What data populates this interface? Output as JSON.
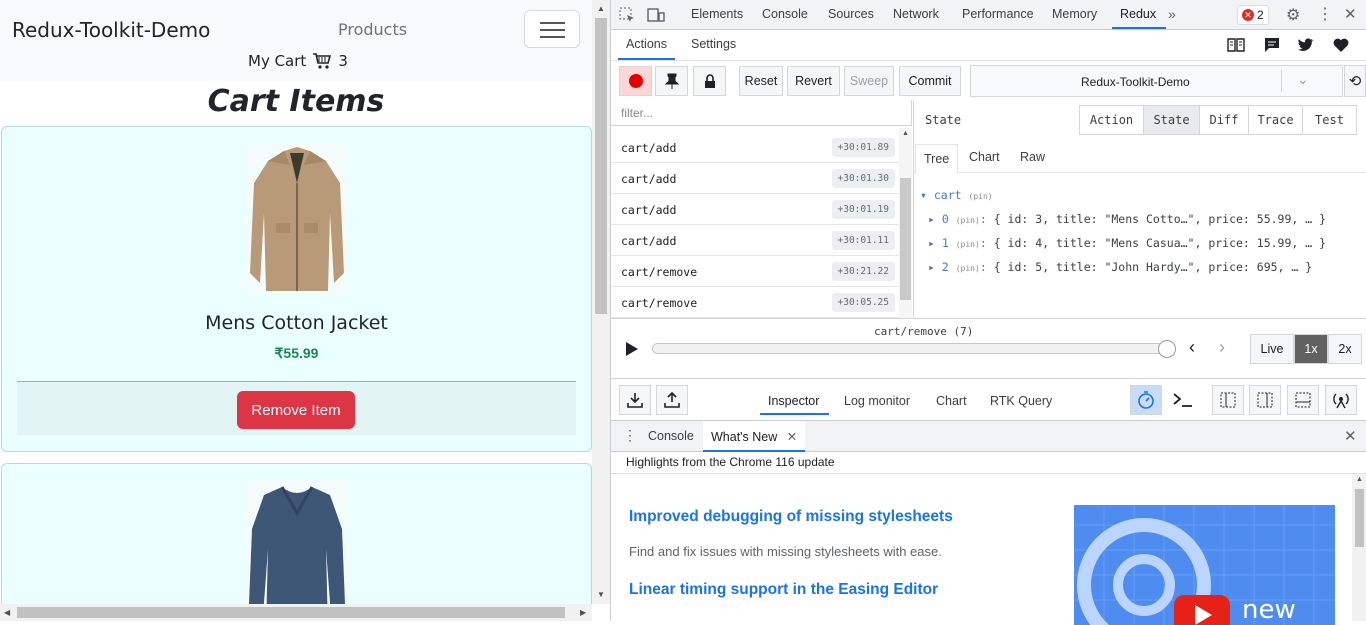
{
  "app": {
    "brand": "Redux-Toolkit-Demo",
    "nav_products": "Products",
    "cart_label": "My Cart",
    "cart_count": "3",
    "heading": "Cart Items"
  },
  "cart_items": [
    {
      "title": "Mens Cotton Jacket",
      "price": "₹55.99",
      "button": "Remove Item"
    }
  ],
  "devtools": {
    "tabs": [
      "Elements",
      "Console",
      "Sources",
      "Network",
      "Performance",
      "Memory",
      "Redux"
    ],
    "error_count": "2",
    "redux": {
      "top_tabs": [
        "Actions",
        "Settings"
      ],
      "buttons": {
        "reset": "Reset",
        "revert": "Revert",
        "sweep": "Sweep",
        "commit": "Commit"
      },
      "instance": "Redux-Toolkit-Demo",
      "filter_placeholder": "filter...",
      "actions": [
        {
          "name": "cart/add",
          "time": "+30:01.89"
        },
        {
          "name": "cart/add",
          "time": "+30:01.30"
        },
        {
          "name": "cart/add",
          "time": "+30:01.19"
        },
        {
          "name": "cart/add",
          "time": "+30:01.11"
        },
        {
          "name": "cart/remove",
          "time": "+30:21.22"
        },
        {
          "name": "cart/remove",
          "time": "+30:05.25"
        }
      ],
      "state_title": "State",
      "monitor_tabs": [
        "Action",
        "State",
        "Diff",
        "Trace",
        "Test"
      ],
      "view_tabs": [
        "Tree",
        "Chart",
        "Raw"
      ],
      "tree": {
        "root": "cart",
        "pin": "(pin)",
        "rows": [
          {
            "key": "0",
            "value": "{ id: 3, title: \"Mens Cotto…\", price: 55.99, … }"
          },
          {
            "key": "1",
            "value": "{ id: 4, title: \"Mens Casua…\", price: 15.99, … }"
          },
          {
            "key": "2",
            "value": "{ id: 5, title: \"John Hardy…\", price: 695, … }"
          }
        ]
      },
      "slider_label": "cart/remove (7)",
      "speed": [
        "Live",
        "1x",
        "2x"
      ],
      "bottom_tabs": [
        "Inspector",
        "Log monitor",
        "Chart",
        "RTK Query"
      ]
    },
    "drawer": {
      "tabs": [
        "Console",
        "What's New"
      ],
      "highlights": "Highlights from the Chrome 116 update",
      "items": [
        {
          "title": "Improved debugging of missing stylesheets",
          "desc": "Find and fix issues with missing stylesheets with ease."
        },
        {
          "title": "Linear timing support in the Easing Editor"
        }
      ],
      "video_word": "new"
    }
  }
}
